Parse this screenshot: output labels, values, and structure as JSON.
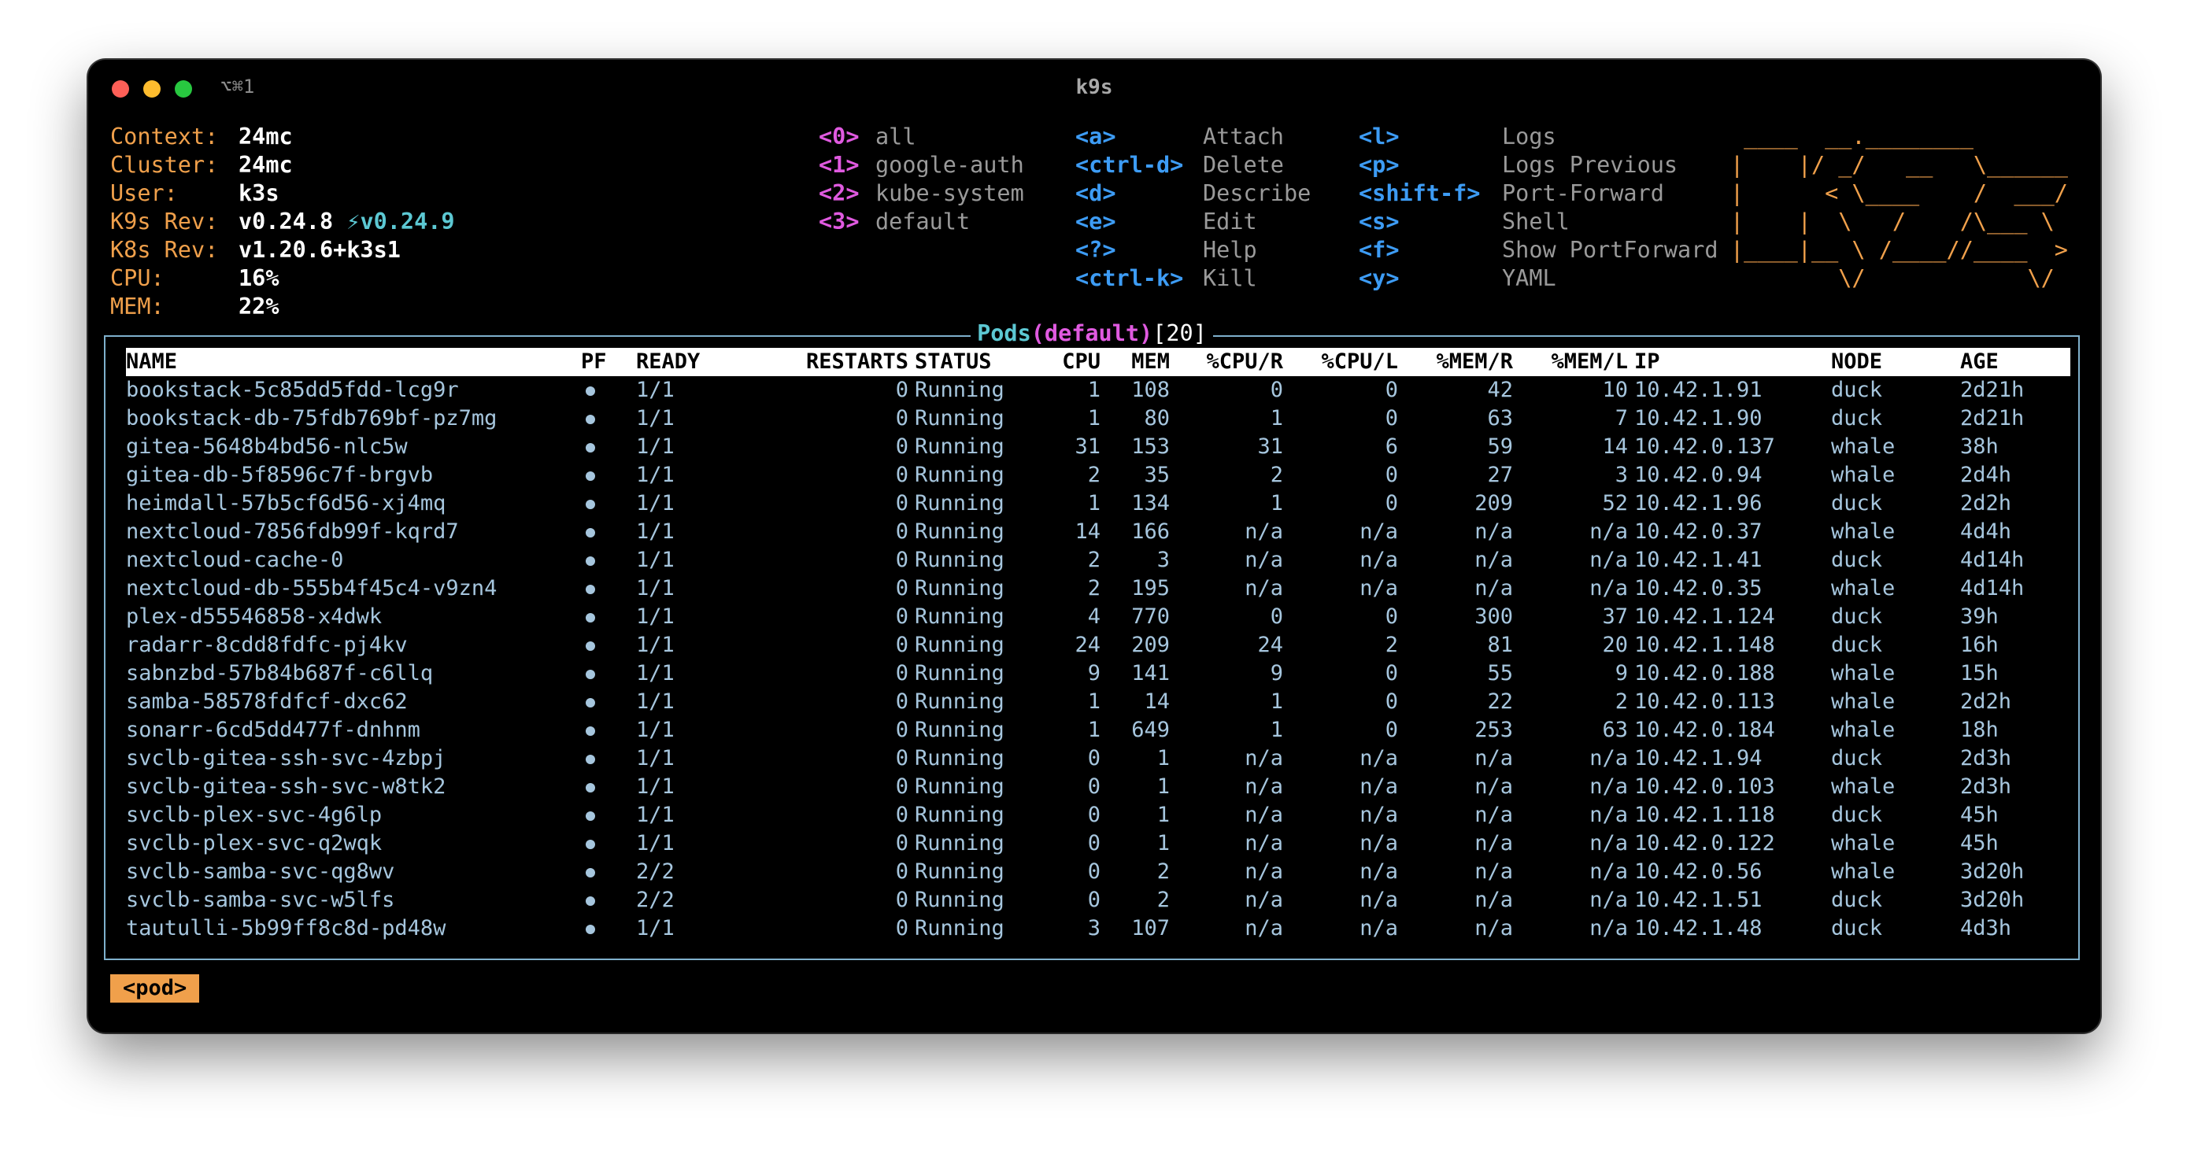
{
  "window": {
    "title": "k9s",
    "shortcut": "⌥⌘1"
  },
  "info": [
    {
      "label": "Context:",
      "value": "24mc"
    },
    {
      "label": "Cluster:",
      "value": "24mc"
    },
    {
      "label": "User:",
      "value": "k3s"
    },
    {
      "label": "K9s Rev:",
      "value": "v0.24.8",
      "upgrade": "⚡v0.24.9"
    },
    {
      "label": "K8s Rev:",
      "value": "v1.20.6+k3s1"
    },
    {
      "label": "CPU:",
      "value": "16%"
    },
    {
      "label": "MEM:",
      "value": "22%"
    }
  ],
  "namespaces": [
    {
      "key": "<0>",
      "label": "all"
    },
    {
      "key": "<1>",
      "label": "google-auth"
    },
    {
      "key": "<2>",
      "label": "kube-system"
    },
    {
      "key": "<3>",
      "label": "default"
    }
  ],
  "hotkeys_a": [
    {
      "key": "<a>",
      "label": "Attach"
    },
    {
      "key": "<ctrl-d>",
      "label": "Delete"
    },
    {
      "key": "<d>",
      "label": "Describe"
    },
    {
      "key": "<e>",
      "label": "Edit"
    },
    {
      "key": "<?>",
      "label": "Help"
    },
    {
      "key": "<ctrl-k>",
      "label": "Kill"
    }
  ],
  "hotkeys_b": [
    {
      "key": "<l>",
      "label": "Logs"
    },
    {
      "key": "<p>",
      "label": "Logs Previous"
    },
    {
      "key": "<shift-f>",
      "label": "Port-Forward"
    },
    {
      "key": "<s>",
      "label": "Shell"
    },
    {
      "key": "<f>",
      "label": "Show PortForward"
    },
    {
      "key": "<y>",
      "label": "YAML"
    }
  ],
  "logo": " ____  __.________       \n|    |/ _/   __   \\______\n|      < \\____    /  ___/\n|    |  \\   /    /\\___ \\ \n|____|__ \\ /____//____  >\n        \\/            \\/ ",
  "pods": {
    "title": "Pods",
    "namespace": "default",
    "count": "20",
    "columns": [
      "NAME",
      "PF",
      "READY",
      "RESTARTS",
      "STATUS",
      "CPU",
      "MEM",
      "%CPU/R",
      "%CPU/L",
      "%MEM/R",
      "%MEM/L",
      "IP",
      "NODE",
      "AGE"
    ],
    "rows": [
      [
        "bookstack-5c85dd5fdd-lcg9r",
        "1/1",
        "0",
        "Running",
        "1",
        "108",
        "0",
        "0",
        "42",
        "10",
        "10.42.1.91",
        "duck",
        "2d21h"
      ],
      [
        "bookstack-db-75fdb769bf-pz7mg",
        "1/1",
        "0",
        "Running",
        "1",
        "80",
        "1",
        "0",
        "63",
        "7",
        "10.42.1.90",
        "duck",
        "2d21h"
      ],
      [
        "gitea-5648b4bd56-nlc5w",
        "1/1",
        "0",
        "Running",
        "31",
        "153",
        "31",
        "6",
        "59",
        "14",
        "10.42.0.137",
        "whale",
        "38h"
      ],
      [
        "gitea-db-5f8596c7f-brgvb",
        "1/1",
        "0",
        "Running",
        "2",
        "35",
        "2",
        "0",
        "27",
        "3",
        "10.42.0.94",
        "whale",
        "2d4h"
      ],
      [
        "heimdall-57b5cf6d56-xj4mq",
        "1/1",
        "0",
        "Running",
        "1",
        "134",
        "1",
        "0",
        "209",
        "52",
        "10.42.1.96",
        "duck",
        "2d2h"
      ],
      [
        "nextcloud-7856fdb99f-kqrd7",
        "1/1",
        "0",
        "Running",
        "14",
        "166",
        "n/a",
        "n/a",
        "n/a",
        "n/a",
        "10.42.0.37",
        "whale",
        "4d4h"
      ],
      [
        "nextcloud-cache-0",
        "1/1",
        "0",
        "Running",
        "2",
        "3",
        "n/a",
        "n/a",
        "n/a",
        "n/a",
        "10.42.1.41",
        "duck",
        "4d14h"
      ],
      [
        "nextcloud-db-555b4f45c4-v9zn4",
        "1/1",
        "0",
        "Running",
        "2",
        "195",
        "n/a",
        "n/a",
        "n/a",
        "n/a",
        "10.42.0.35",
        "whale",
        "4d14h"
      ],
      [
        "plex-d55546858-x4dwk",
        "1/1",
        "0",
        "Running",
        "4",
        "770",
        "0",
        "0",
        "300",
        "37",
        "10.42.1.124",
        "duck",
        "39h"
      ],
      [
        "radarr-8cdd8fdfc-pj4kv",
        "1/1",
        "0",
        "Running",
        "24",
        "209",
        "24",
        "2",
        "81",
        "20",
        "10.42.1.148",
        "duck",
        "16h"
      ],
      [
        "sabnzbd-57b84b687f-c6llq",
        "1/1",
        "0",
        "Running",
        "9",
        "141",
        "9",
        "0",
        "55",
        "9",
        "10.42.0.188",
        "whale",
        "15h"
      ],
      [
        "samba-58578fdfcf-dxc62",
        "1/1",
        "0",
        "Running",
        "1",
        "14",
        "1",
        "0",
        "22",
        "2",
        "10.42.0.113",
        "whale",
        "2d2h"
      ],
      [
        "sonarr-6cd5dd477f-dnhnm",
        "1/1",
        "0",
        "Running",
        "1",
        "649",
        "1",
        "0",
        "253",
        "63",
        "10.42.0.184",
        "whale",
        "18h"
      ],
      [
        "svclb-gitea-ssh-svc-4zbpj",
        "1/1",
        "0",
        "Running",
        "0",
        "1",
        "n/a",
        "n/a",
        "n/a",
        "n/a",
        "10.42.1.94",
        "duck",
        "2d3h"
      ],
      [
        "svclb-gitea-ssh-svc-w8tk2",
        "1/1",
        "0",
        "Running",
        "0",
        "1",
        "n/a",
        "n/a",
        "n/a",
        "n/a",
        "10.42.0.103",
        "whale",
        "2d3h"
      ],
      [
        "svclb-plex-svc-4g6lp",
        "1/1",
        "0",
        "Running",
        "0",
        "1",
        "n/a",
        "n/a",
        "n/a",
        "n/a",
        "10.42.1.118",
        "duck",
        "45h"
      ],
      [
        "svclb-plex-svc-q2wqk",
        "1/1",
        "0",
        "Running",
        "0",
        "1",
        "n/a",
        "n/a",
        "n/a",
        "n/a",
        "10.42.0.122",
        "whale",
        "45h"
      ],
      [
        "svclb-samba-svc-qg8wv",
        "2/2",
        "0",
        "Running",
        "0",
        "2",
        "n/a",
        "n/a",
        "n/a",
        "n/a",
        "10.42.0.56",
        "whale",
        "3d20h"
      ],
      [
        "svclb-samba-svc-w5lfs",
        "2/2",
        "0",
        "Running",
        "0",
        "2",
        "n/a",
        "n/a",
        "n/a",
        "n/a",
        "10.42.1.51",
        "duck",
        "3d20h"
      ],
      [
        "tautulli-5b99ff8c8d-pd48w",
        "1/1",
        "0",
        "Running",
        "3",
        "107",
        "n/a",
        "n/a",
        "n/a",
        "n/a",
        "10.42.1.48",
        "duck",
        "4d3h"
      ]
    ]
  },
  "breadcrumb": "<pod>"
}
